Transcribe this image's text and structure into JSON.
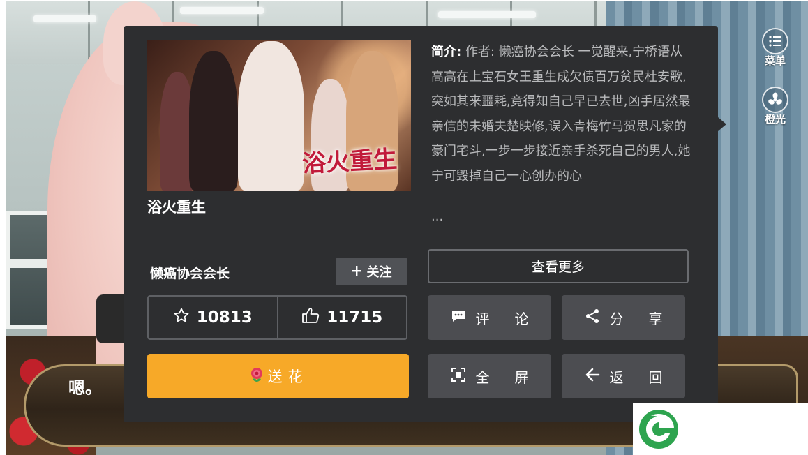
{
  "dialogue": {
    "text": "嗯。"
  },
  "side_menu": [
    {
      "label": "菜单",
      "icon": "list-icon"
    },
    {
      "label": "橙光",
      "icon": "fan-icon"
    }
  ],
  "novel": {
    "title": "浴火重生",
    "cover_title": "浴火重生",
    "synopsis_label": "简介:",
    "synopsis": "作者: 懒癌协会会长 一觉醒来,宁桥语从高高在上宝石女王重生成欠债百万贫民杜安歌,突如其来噩耗,竟得知自己早已去世,凶手居然最亲信的未婚夫楚映修,误入青梅竹马贺思凡家的豪门宅斗,一步一步接近亲手杀死自己的男人,她宁可毁掉自己一心创办的心",
    "synopsis_ellipsis": "..."
  },
  "author": {
    "name": "懒癌协会会长",
    "follow_label": "关注"
  },
  "stats": {
    "favorites": "10813",
    "likes": "11715"
  },
  "buttons": {
    "flower": "送花",
    "more": "查看更多",
    "comment": "评论",
    "share": "分享",
    "fullscreen": "全屏",
    "back": "返回"
  },
  "colors": {
    "panel": "#2d2e30",
    "flower_button": "#f7a928",
    "action_button": "#4c4d51",
    "logo_green": "#2ea44f"
  }
}
